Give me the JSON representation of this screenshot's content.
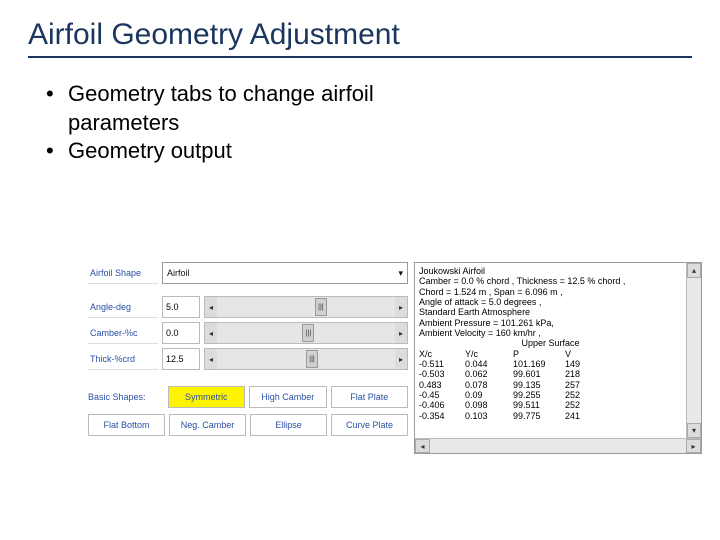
{
  "title": "Airfoil Geometry Adjustment",
  "bullets": {
    "b1_line1": "Geometry tabs to change airfoil",
    "b1_line2": "parameters",
    "b2": "Geometry output"
  },
  "left": {
    "shape_label": "Airfoil Shape",
    "shape_value": "Airfoil",
    "angle": {
      "label": "Angle-deg",
      "value": "5.0"
    },
    "camber": {
      "label": "Camber-%c",
      "value": "0.0"
    },
    "thick": {
      "label": "Thick-%crd",
      "value": "12.5"
    },
    "row1": {
      "label": "Basic Shapes:",
      "b1": "Symmetric",
      "b2": "High Camber",
      "b3": "Flat Plate"
    },
    "row2": {
      "b1": "Flat Bottom",
      "b2": "Neg. Camber",
      "b3": "Ellipse",
      "b4": "Curve Plate"
    }
  },
  "right": {
    "l1": "Joukowski Airfoil",
    "l2": "Camber = 0.0 % chord , Thickness = 12.5 % chord ,",
    "l3": "Chord = 1.524 m , Span = 6.096 m ,",
    "l4": "Angle of attack = 5.0 degrees ,",
    "l5": "Standard Earth Atmosphere",
    "l6": "Ambient Pressure = 101.261 kPa,",
    "l7": "Ambient Velocity = 160 km/hr ,",
    "surface": "Upper Surface",
    "hdr": {
      "c1": "X/c",
      "c2": "Y/c",
      "c3": "P",
      "c4": "V"
    },
    "rows": [
      {
        "c1": "-0.511",
        "c2": "0.044",
        "c3": "101.169",
        "c4": "149"
      },
      {
        "c1": "-0.503",
        "c2": "0.062",
        "c3": "99.601",
        "c4": "218"
      },
      {
        "c1": "0.483",
        "c2": "0.078",
        "c3": "99.135",
        "c4": "257"
      },
      {
        "c1": "-0.45",
        "c2": "0.09",
        "c3": "99.255",
        "c4": "252"
      },
      {
        "c1": "-0.406",
        "c2": "0.098",
        "c3": "99.511",
        "c4": "252"
      },
      {
        "c1": "-0.354",
        "c2": "0.103",
        "c3": "99.775",
        "c4": "241"
      }
    ]
  }
}
